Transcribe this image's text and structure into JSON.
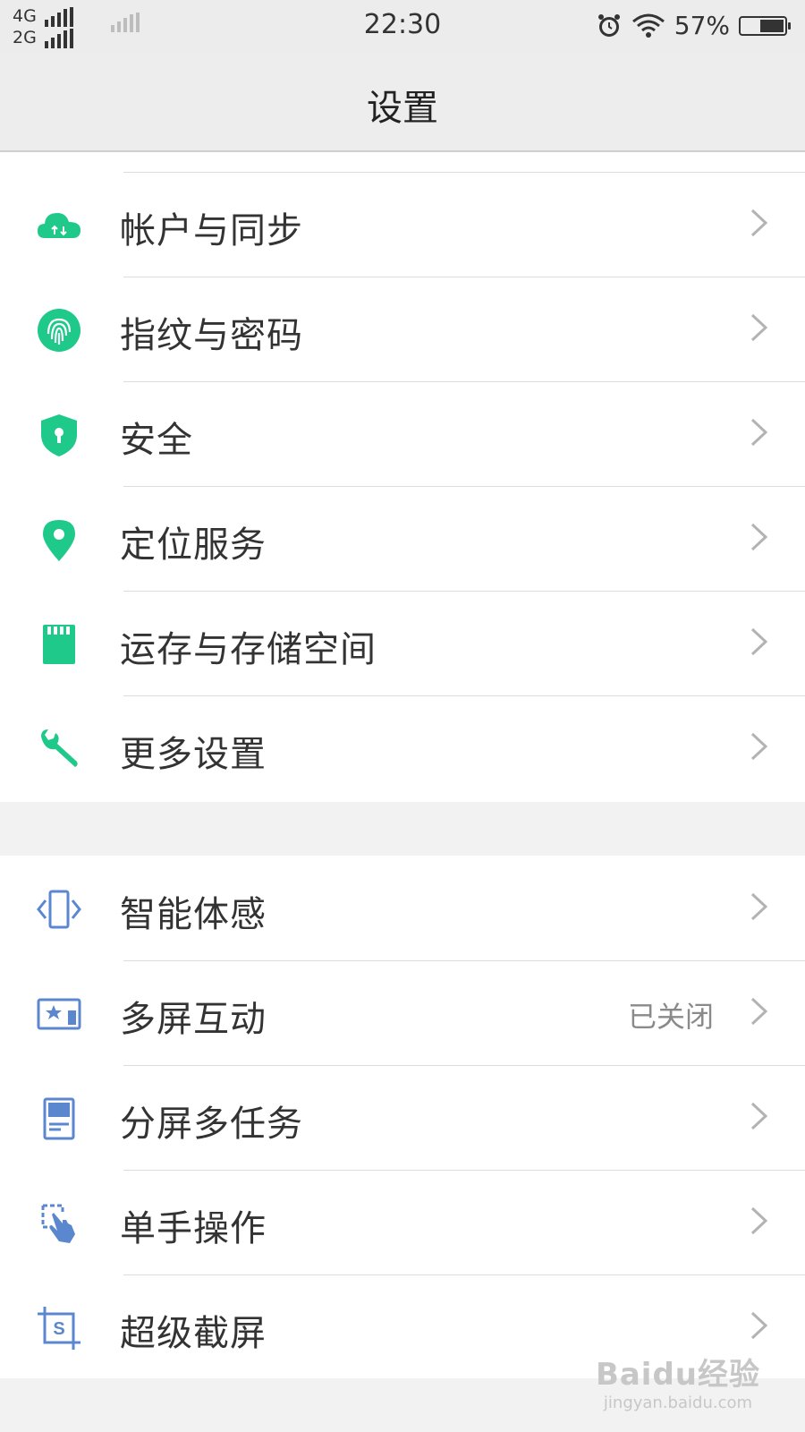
{
  "status_bar": {
    "net_top": "4G",
    "net_bottom": "2G",
    "time": "22:30",
    "battery": "57%",
    "battery_level": 0.57
  },
  "header": {
    "title": "设置"
  },
  "group1": {
    "items": [
      {
        "label": "帐户与同步",
        "icon": "cloud-sync-icon"
      },
      {
        "label": "指纹与密码",
        "icon": "fingerprint-icon"
      },
      {
        "label": "安全",
        "icon": "shield-icon"
      },
      {
        "label": "定位服务",
        "icon": "location-pin-icon"
      },
      {
        "label": "运存与存储空间",
        "icon": "sd-card-icon"
      },
      {
        "label": "更多设置",
        "icon": "wrench-icon"
      }
    ]
  },
  "group2": {
    "items": [
      {
        "label": "智能体感",
        "icon": "motion-sense-icon"
      },
      {
        "label": "多屏互动",
        "icon": "multi-screen-icon",
        "value": "已关闭"
      },
      {
        "label": "分屏多任务",
        "icon": "split-screen-icon"
      },
      {
        "label": "单手操作",
        "icon": "one-hand-icon"
      },
      {
        "label": "超级截屏",
        "icon": "screenshot-icon"
      }
    ]
  },
  "watermark": {
    "brand": "Baidu经验",
    "sub": "jingyan.baidu.com"
  },
  "colors": {
    "green": "#1ec98a",
    "blue": "#5b87cf",
    "chevron": "#b3b3b3"
  }
}
